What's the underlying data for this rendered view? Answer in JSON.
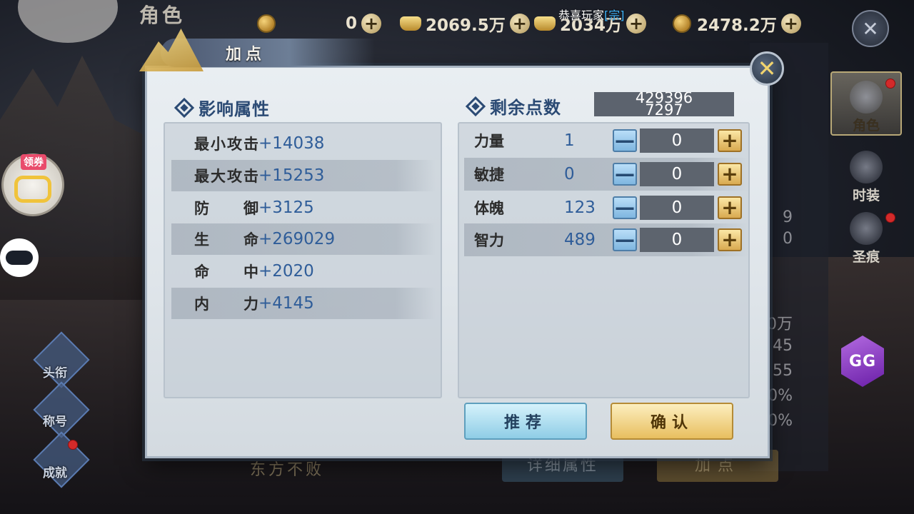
{
  "background": {
    "title": "角色",
    "bottom_left_name": "东方不败",
    "bottom_btn_detail": "详细属性",
    "bottom_btn_addpoint": "加点",
    "right_values": [
      "9",
      "0",
      "0万",
      "45",
      "55",
      "0%",
      "0%"
    ]
  },
  "topbar": {
    "currency1": "0",
    "currency2": "2069.5万",
    "currency3": "2034万",
    "currency4": "2478.2万",
    "announce_text": "恭喜玩家",
    "announce_tag": "[宗]"
  },
  "side_tabs": [
    {
      "label": "角色"
    },
    {
      "label": "时装"
    },
    {
      "label": "圣痕"
    }
  ],
  "left_float": {
    "coupon_tag": "领券",
    "menu": [
      {
        "label": "头衔"
      },
      {
        "label": "称号"
      },
      {
        "label": "成就"
      }
    ]
  },
  "gg": {
    "label": "GG"
  },
  "dialog": {
    "title": "加点",
    "left_section_title": "影响属性",
    "right_section_title": "剩余点数",
    "remaining_points": "429396\n7297",
    "stats": [
      {
        "name": "最小攻击",
        "value": "+14038"
      },
      {
        "name": "最大攻击",
        "value": "+15253"
      },
      {
        "name": "防御",
        "value": "+3125"
      },
      {
        "name": "生命",
        "value": "+269029"
      },
      {
        "name": "命中",
        "value": "+2020"
      },
      {
        "name": "内力",
        "value": "+4145"
      }
    ],
    "attributes": [
      {
        "name": "力量",
        "value": "1",
        "add": "0"
      },
      {
        "name": "敏捷",
        "value": "0",
        "add": "0"
      },
      {
        "name": "体魄",
        "value": "123",
        "add": "0"
      },
      {
        "name": "智力",
        "value": "489",
        "add": "0"
      }
    ],
    "minus_symbol": "—",
    "plus_symbol": "+",
    "recommend_label": "推荐",
    "confirm_label": "确认"
  }
}
